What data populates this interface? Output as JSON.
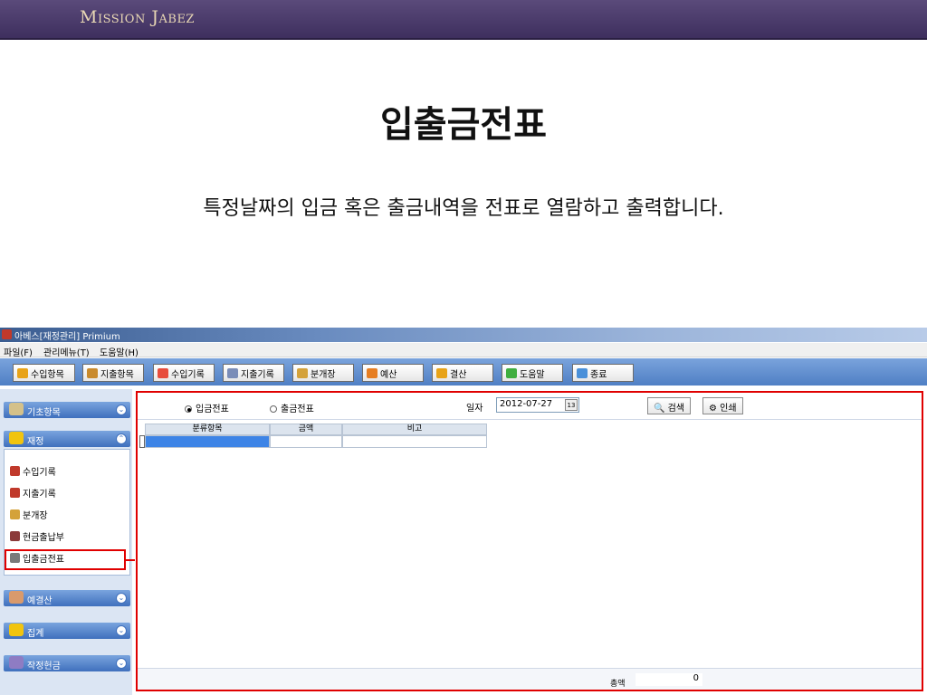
{
  "slide": {
    "brand": "Mission Jabez",
    "title": "입출금전표",
    "description": "특정날짜의 입금 혹은 출금내역을 전표로 열람하고 출력합니다."
  },
  "window": {
    "title": "아베스[재정관리] Primium"
  },
  "menu": [
    "파일(F)",
    "관리메뉴(T)",
    "도움말(H)"
  ],
  "toolbar": [
    {
      "label": "수입항목",
      "icon": "coins-icon",
      "color": "#e8a317"
    },
    {
      "label": "지출항목",
      "icon": "tag-icon",
      "color": "#c98a2c"
    },
    {
      "label": "수입기록",
      "icon": "pencil-icon",
      "color": "#e74c3c"
    },
    {
      "label": "지출기록",
      "icon": "check-pencil-icon",
      "color": "#7a8db8"
    },
    {
      "label": "분개장",
      "icon": "diamond-icon",
      "color": "#d4a23a"
    },
    {
      "label": "예산",
      "icon": "bar-chart-icon",
      "color": "#e67e22"
    },
    {
      "label": "결산",
      "icon": "coins-icon",
      "color": "#e8a317"
    },
    {
      "label": "도움말",
      "icon": "sprout-icon",
      "color": "#3fae3f"
    },
    {
      "label": "종료",
      "icon": "exit-icon",
      "color": "#4a90d9"
    }
  ],
  "sidebar": {
    "sections": [
      {
        "label": "기초항목",
        "icon": "document-icon",
        "color": "#d4c18a"
      },
      {
        "label": "재정",
        "icon": "coins-icon",
        "color": "#f1c40f"
      },
      {
        "label": "예결산",
        "icon": "book-icon",
        "color": "#d99a6c"
      },
      {
        "label": "집계",
        "icon": "stack-icon",
        "color": "#f1c40f"
      },
      {
        "label": "작정헌금",
        "icon": "gift-icon",
        "color": "#8e7cc3"
      }
    ],
    "items": [
      {
        "label": "수입기록",
        "icon": "edit-icon",
        "color": "#c0392b"
      },
      {
        "label": "지출기록",
        "icon": "edit-icon",
        "color": "#c0392b"
      },
      {
        "label": "분개장",
        "icon": "coins-icon",
        "color": "#d4a23a"
      },
      {
        "label": "현금출납부",
        "icon": "safe-icon",
        "color": "#8b3a3a"
      },
      {
        "label": "입출금전표",
        "icon": "voucher-icon",
        "color": "#7a7a7a"
      }
    ]
  },
  "form": {
    "radio_income": "입금전표",
    "radio_expense": "출금전표",
    "date_label": "일자",
    "date_value": "2012-07-27",
    "calendar_label": "13",
    "search_label": "검색",
    "print_label": "인쇄"
  },
  "grid": {
    "columns": [
      "분류항목",
      "금액",
      "비고"
    ]
  },
  "footer": {
    "total_label": "총액",
    "total_value": "0"
  }
}
